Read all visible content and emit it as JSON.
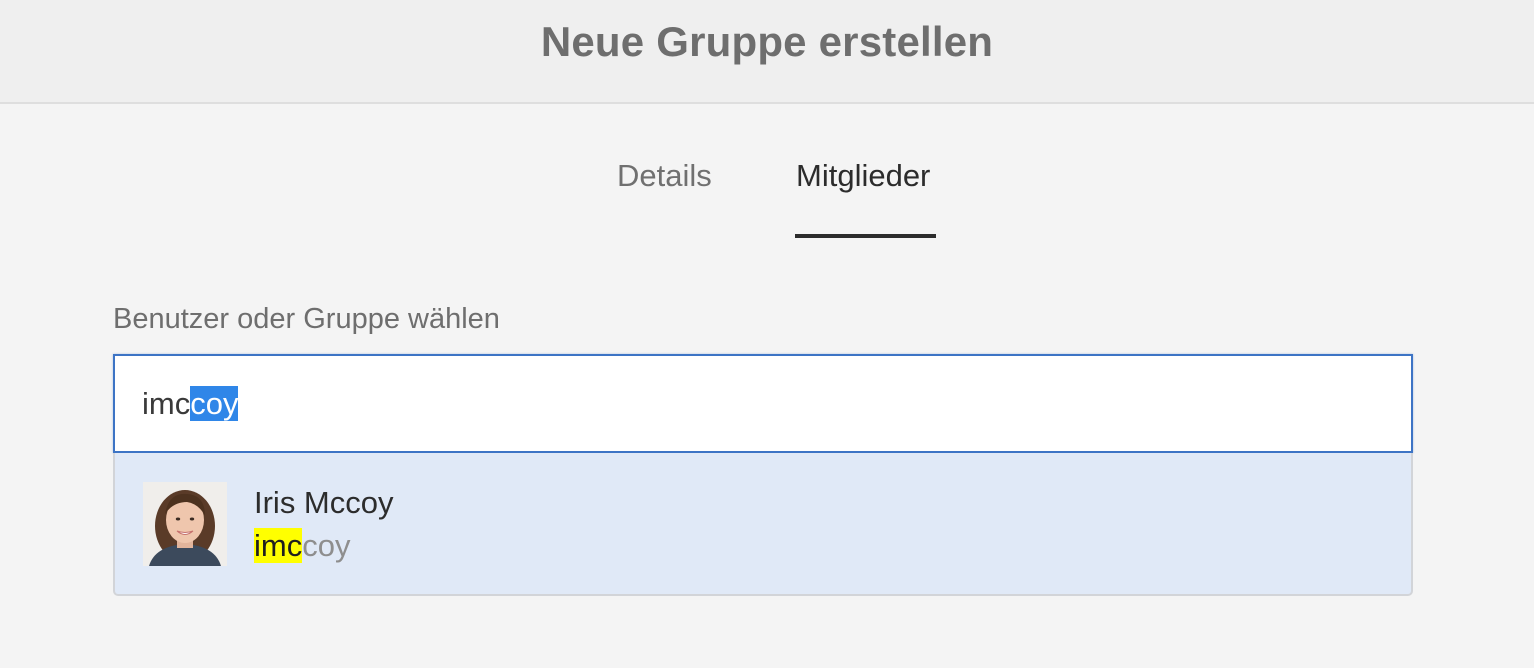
{
  "dialog": {
    "title": "Neue Gruppe erstellen"
  },
  "tabs": {
    "items": [
      {
        "label": "Details",
        "active": false
      },
      {
        "label": "Mitglieder",
        "active": true
      }
    ]
  },
  "member_picker": {
    "label": "Benutzer oder Gruppe wählen",
    "query_typed": "imc",
    "query_autocomplete": "coy",
    "suggestions": [
      {
        "name": "Iris Mccoy",
        "id_match": "imc",
        "id_rest": "coy",
        "avatar": "person-photo"
      }
    ]
  },
  "colors": {
    "accent_blue": "#3d74c5",
    "selection_blue": "#2f86e8",
    "suggestion_bg": "#e0e9f7",
    "match_highlight": "#ffff00",
    "tab_indicator": "#2c2c2c"
  }
}
